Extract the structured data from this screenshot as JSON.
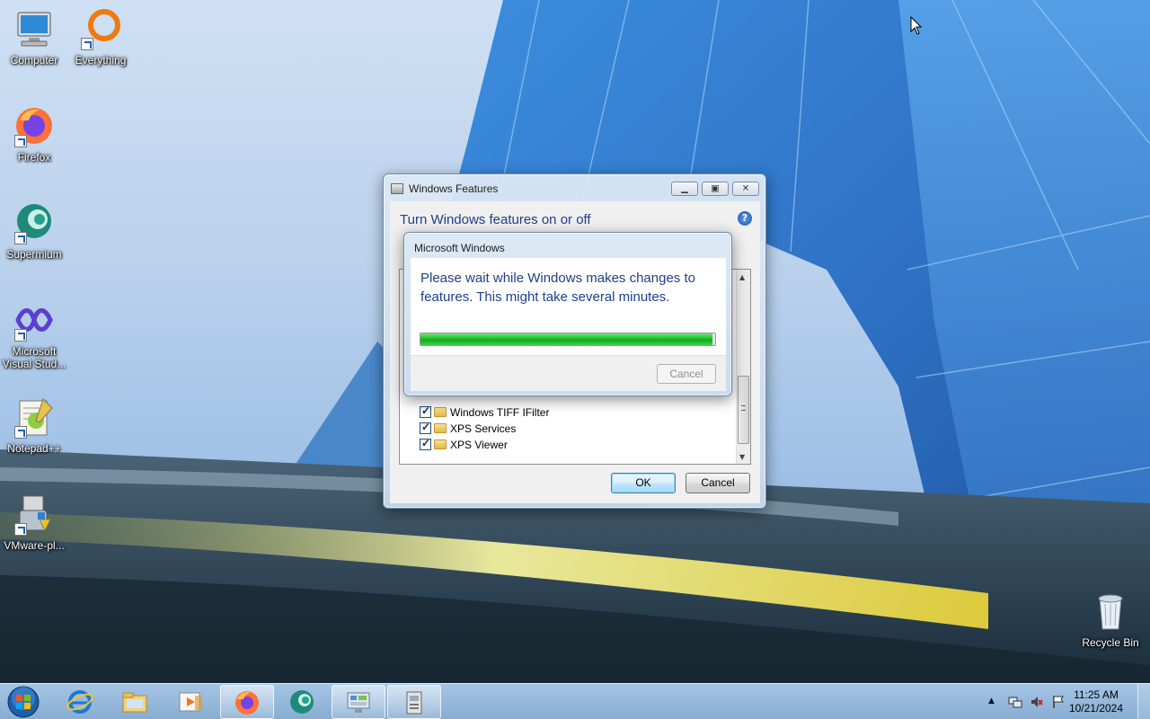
{
  "desktop": {
    "icons": [
      {
        "label": "Computer"
      },
      {
        "label": "Everything"
      },
      {
        "label": "Firefox"
      },
      {
        "label": "Supermium"
      },
      {
        "label": "Microsoft Visual Stud..."
      },
      {
        "label": "Notepad++"
      },
      {
        "label": "VMware-pl..."
      },
      {
        "label": "Recycle Bin"
      }
    ]
  },
  "features_window": {
    "title": "Windows Features",
    "heading": "Turn Windows features on or off",
    "help_icon": "help-icon",
    "items": [
      {
        "label": "Windows TIFF IFilter",
        "checked": true
      },
      {
        "label": "XPS Services",
        "checked": true
      },
      {
        "label": "XPS Viewer",
        "checked": true
      }
    ],
    "ok_label": "OK",
    "cancel_label": "Cancel"
  },
  "progress_dialog": {
    "title": "Microsoft Windows",
    "message": "Please wait while Windows makes changes to features. This might take several minutes.",
    "progress": 0.99,
    "cancel_label": "Cancel"
  },
  "taskbar": {
    "buttons": [
      "start-orb-icon",
      "internet-explorer-icon",
      "file-explorer-icon",
      "media-player-icon",
      "firefox-icon",
      "supermium-icon",
      "control-panel-icon",
      "windows-features-icon"
    ],
    "time": "11:25 AM",
    "date": "10/21/2024"
  },
  "colors": {
    "accent_blue": "#1e3f8c",
    "progress_green": "#21c12b"
  }
}
